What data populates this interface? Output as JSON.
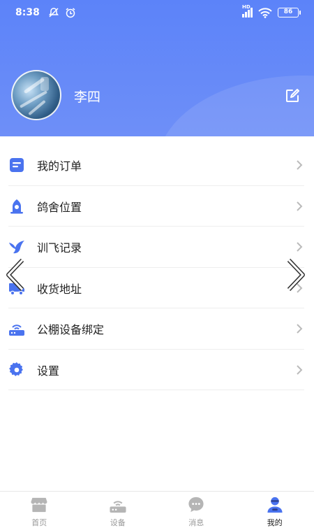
{
  "status_bar": {
    "time": "8:38",
    "battery": "86",
    "network": "HD"
  },
  "profile": {
    "name": "李四"
  },
  "menu": {
    "items": [
      {
        "label": "我的订单",
        "icon": "order-list-icon"
      },
      {
        "label": "鸽舍位置",
        "icon": "location-pin-icon"
      },
      {
        "label": "训飞记录",
        "icon": "bird-flight-icon"
      },
      {
        "label": "收货地址",
        "icon": "delivery-truck-icon"
      },
      {
        "label": "公棚设备绑定",
        "icon": "router-device-icon"
      },
      {
        "label": "设置",
        "icon": "gear-icon"
      }
    ]
  },
  "tabbar": {
    "tabs": [
      {
        "label": "首页",
        "icon": "home-store-icon",
        "active": false
      },
      {
        "label": "设备",
        "icon": "device-router-icon",
        "active": false
      },
      {
        "label": "消息",
        "icon": "message-icon",
        "active": false
      },
      {
        "label": "我的",
        "icon": "user-profile-icon",
        "active": true
      }
    ]
  },
  "colors": {
    "accent": "#5b7ff6",
    "header_top": "#5c83f9",
    "header_bottom": "#6e8ff8",
    "icon_blue": "#4a73ef",
    "inactive_tab": "#b5b5b5"
  }
}
